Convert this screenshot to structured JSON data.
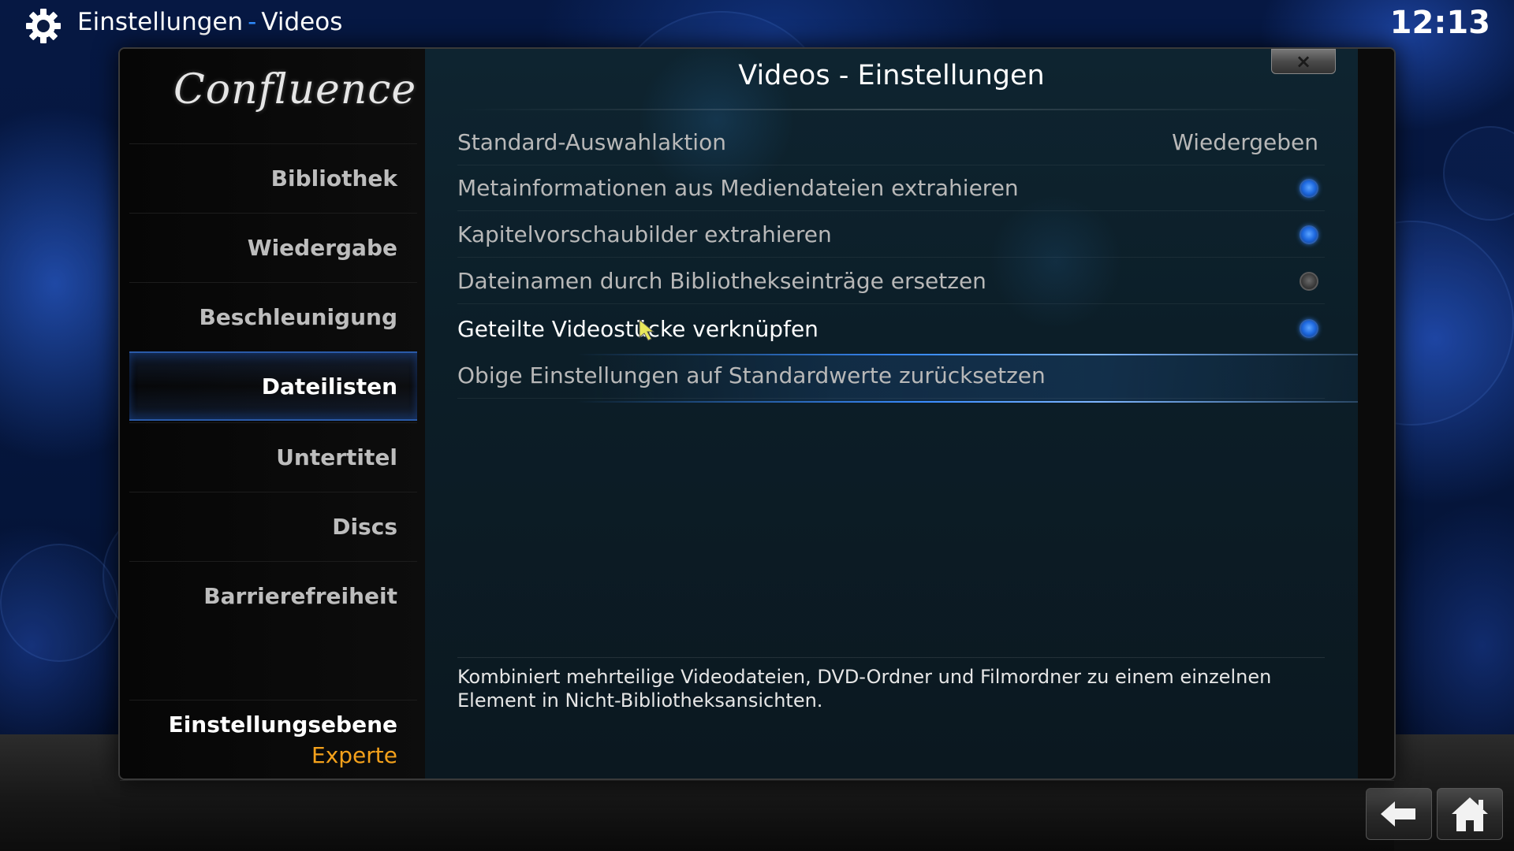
{
  "header": {
    "section": "Einstellungen",
    "separator": "-",
    "page": "Videos",
    "clock": "12:13"
  },
  "dialog": {
    "title": "Videos - Einstellungen",
    "close_label": "×",
    "logo": "Confluence"
  },
  "sidebar": {
    "items": [
      {
        "label": "Bibliothek",
        "active": false
      },
      {
        "label": "Wiedergabe",
        "active": false
      },
      {
        "label": "Beschleunigung",
        "active": false
      },
      {
        "label": "Dateilisten",
        "active": true
      },
      {
        "label": "Untertitel",
        "active": false
      },
      {
        "label": "Discs",
        "active": false
      },
      {
        "label": "Barrierefreiheit",
        "active": false
      }
    ],
    "level_label": "Einstellungsebene",
    "level_value": "Experte"
  },
  "settings": [
    {
      "label": "Standard-Auswahlaktion",
      "value": "Wiedergeben"
    },
    {
      "label": "Metainformationen aus Mediendateien extrahieren",
      "enabled": true
    },
    {
      "label": "Kapitelvorschaubilder extrahieren",
      "enabled": true
    },
    {
      "label": "Dateinamen durch Bibliothekseinträge ersetzen",
      "enabled": false
    },
    {
      "label": "Geteilte Videostücke verknüpfen",
      "enabled": true,
      "focused": true
    },
    {
      "label": "Obige Einstellungen auf Standardwerte zurücksetzen"
    }
  ],
  "description": "Kombiniert mehrteilige Videodateien, DVD-Ordner und Filmordner zu einem einzelnen Element in Nicht-Bibliotheksansichten.",
  "footer": {
    "back_icon": "back-arrow-icon",
    "home_icon": "home-icon"
  },
  "colors": {
    "accent_blue": "#2f8cff",
    "level_orange": "#f4a11b"
  }
}
